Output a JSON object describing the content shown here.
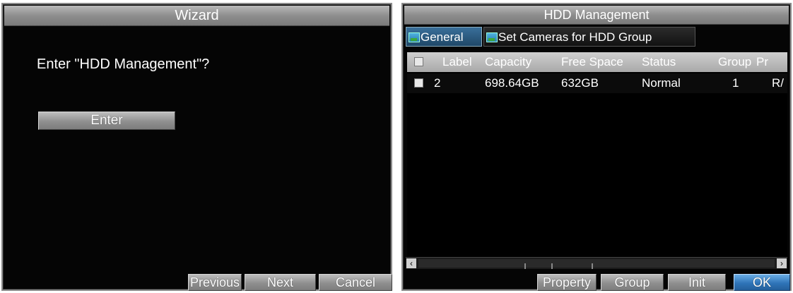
{
  "wizard": {
    "title": "Wizard",
    "prompt": "Enter \"HDD Management\"?",
    "enter_label": "Enter",
    "previous_label": "Previous",
    "next_label": "Next",
    "cancel_label": "Cancel"
  },
  "hdd": {
    "title": "HDD Management",
    "tabs": [
      {
        "label": "General",
        "icon": "tab-icon",
        "selected": true
      },
      {
        "label": "Set Cameras for HDD Group",
        "icon": "tab-icon",
        "selected": false
      }
    ],
    "columns": [
      "Label",
      "Capacity",
      "Free Space",
      "Status",
      "Group",
      "Pr"
    ],
    "rows": [
      {
        "label": "2",
        "capacity": "698.64GB",
        "free_space": "632GB",
        "status": "Normal",
        "group": "1",
        "property": "R/"
      }
    ],
    "buttons": {
      "property": "Property",
      "group": "Group",
      "init": "Init",
      "ok": "OK"
    },
    "accent_color": "#3a7fc0"
  }
}
